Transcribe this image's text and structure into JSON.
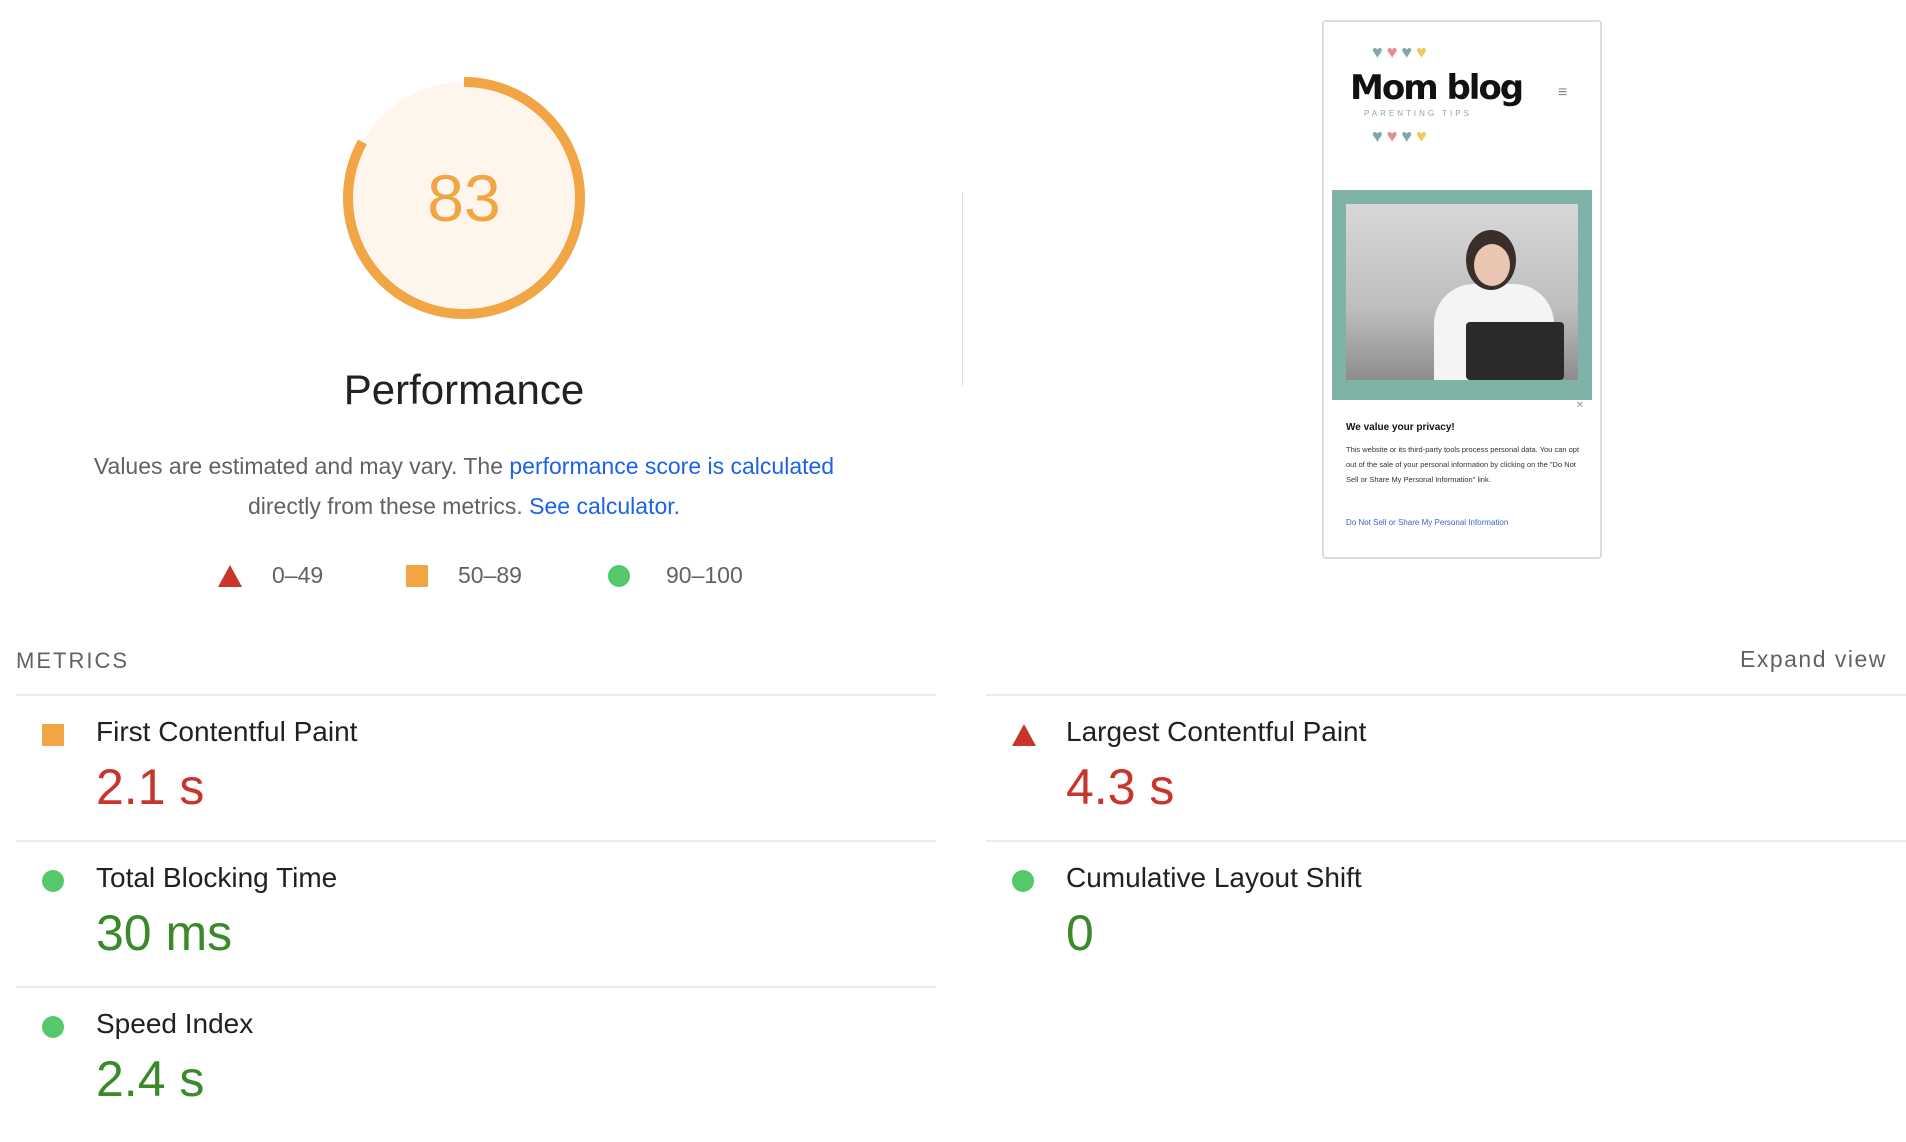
{
  "gauge": {
    "score": "83",
    "fraction": 0.83,
    "color": "#f2a545"
  },
  "performance": {
    "title": "Performance",
    "desc_prefix": "Values are estimated and may vary. The ",
    "desc_link1": "performance score is calculated",
    "desc_middle": " directly from these metrics. ",
    "desc_link2": "See calculator."
  },
  "legend": {
    "fail": "0–49",
    "average": "50–89",
    "pass": "90–100"
  },
  "screenshot": {
    "logo": "Mom blog",
    "logo_sub": "PARENTING TIPS",
    "consent_title": "We value your privacy!",
    "consent_body": "This website or its third-party tools process personal data. You can opt out of the sale of your personal information by clicking on the \"Do Not Sell or Share My Personal Information\" link.",
    "consent_link": "Do Not Sell or Share My Personal Information"
  },
  "metrics": {
    "header": "METRICS",
    "expand": "Expand view",
    "fcp": {
      "label": "First Contentful Paint",
      "value": "2.1 s",
      "status": "average"
    },
    "lcp": {
      "label": "Largest Contentful Paint",
      "value": "4.3 s",
      "status": "fail"
    },
    "tbt": {
      "label": "Total Blocking Time",
      "value": "30 ms",
      "status": "pass"
    },
    "cls": {
      "label": "Cumulative Layout Shift",
      "value": "0",
      "status": "pass"
    },
    "si": {
      "label": "Speed Index",
      "value": "2.4 s",
      "status": "pass"
    }
  }
}
